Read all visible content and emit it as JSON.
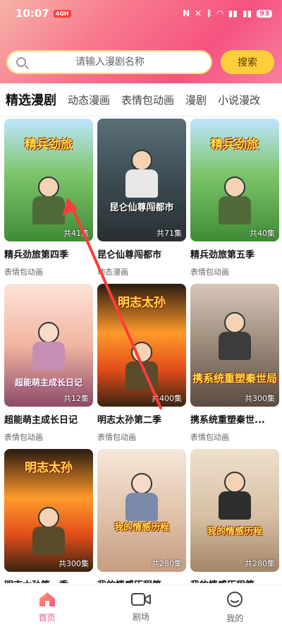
{
  "status_bar": {
    "time": "10:07",
    "badge": "4GH",
    "battery": "93"
  },
  "search": {
    "placeholder": "请输入漫剧名称",
    "button_label": "搜索"
  },
  "tabs": [
    {
      "label": "精选漫剧",
      "active": true
    },
    {
      "label": "动态漫画",
      "active": false
    },
    {
      "label": "表情包动画",
      "active": false
    },
    {
      "label": "漫剧",
      "active": false
    },
    {
      "label": "小说漫改",
      "active": false
    }
  ],
  "cards": [
    {
      "title": "精兵劲旅第四季",
      "category": "表情包动画",
      "episodes": "共41集",
      "cover_text": "精兵劲旅",
      "style": "cv-green"
    },
    {
      "title": "昆仑仙尊闯都市",
      "category": "动态漫画",
      "episodes": "共71集",
      "cover_text": "昆仑仙尊闯都市",
      "style": "cv-dark"
    },
    {
      "title": "精兵劲旅第五季",
      "category": "表情包动画",
      "episodes": "共40集",
      "cover_text": "精兵劲旅",
      "style": "cv-green"
    },
    {
      "title": "超能萌主成长日记",
      "category": "表情包动画",
      "episodes": "共12集",
      "cover_text": "超能萌主成长日记",
      "style": "cv-warm"
    },
    {
      "title": "明志太孙第二季",
      "category": "表情包动画",
      "episodes": "共400集",
      "cover_text": "明志太孙",
      "style": "cv-fire"
    },
    {
      "title": "携系统重塑秦世...",
      "category": "表情包动画",
      "episodes": "共300集",
      "cover_text": "携系统重塑秦世局",
      "style": "cv-gray"
    },
    {
      "title": "明志太孙第一季",
      "category": "",
      "episodes": "共300集",
      "cover_text": "明志太孙",
      "style": "cv-fire"
    },
    {
      "title": "我的情感历程第...",
      "category": "",
      "episodes": "共280集",
      "cover_text": "我的情感历程",
      "style": "cv-soft"
    },
    {
      "title": "我的情感历程第...",
      "category": "",
      "episodes": "共280集",
      "cover_text": "我的情感历程",
      "style": "cv-wall"
    }
  ],
  "bottom_nav": [
    {
      "label": "首页",
      "icon": "home-icon",
      "active": true
    },
    {
      "label": "剧场",
      "icon": "video-camera-icon",
      "active": false
    },
    {
      "label": "我的",
      "icon": "profile-icon",
      "active": false
    }
  ],
  "colors": {
    "accent": "#f5547f",
    "search_button": "#ffcf3b",
    "annotation_arrow": "#ff3b3b"
  }
}
